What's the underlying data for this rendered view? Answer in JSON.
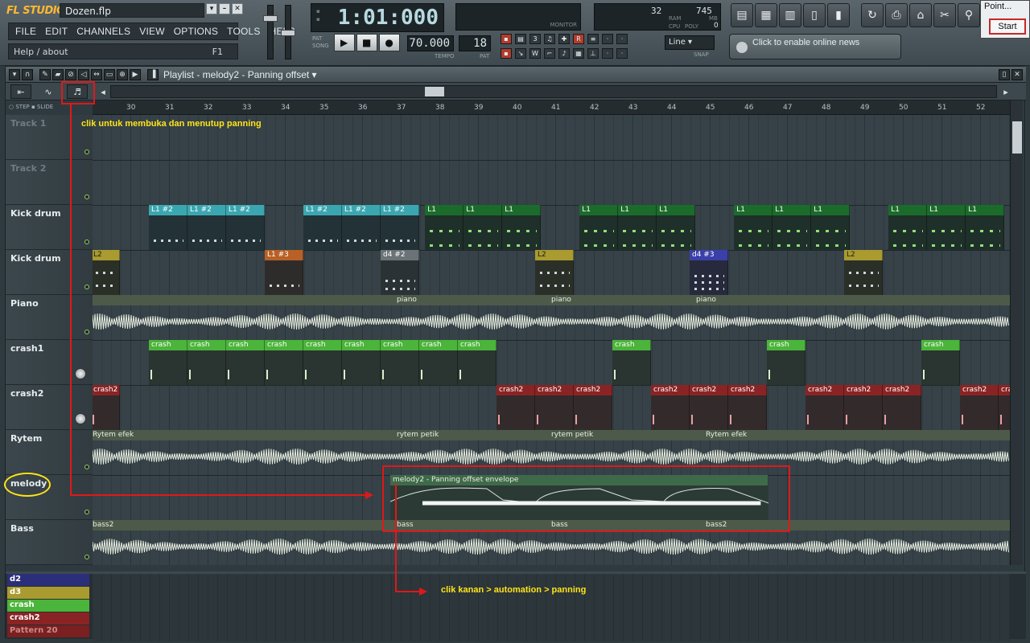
{
  "app": {
    "logo": "FL STUDIO",
    "filename": "Dozen.flp",
    "menu": [
      "FILE",
      "EDIT",
      "CHANNELS",
      "VIEW",
      "OPTIONS",
      "TOOLS",
      "HELP"
    ],
    "help_text": "Help / about",
    "help_key": "F1"
  },
  "transport": {
    "clock": "1:01:000",
    "pat_label": "PAT",
    "song_label": "SONG",
    "tempo": "70.000",
    "tempo_label": "TEMPO",
    "pattern_number": "18",
    "pattern_label": "PAT",
    "snap_value": "Line",
    "snap_label": "SNAP",
    "monitor_label": "MONITOR"
  },
  "cpu": {
    "value1": "32",
    "value2": "745",
    "ram_label": "RAM",
    "cpu_label": "CPU",
    "poly_label": "POLY",
    "mb_label": "MB",
    "poly": "0"
  },
  "news": {
    "text": "Click to enable online news"
  },
  "popup": {
    "title": "Point...",
    "button": "Start"
  },
  "playlist": {
    "title": "Playlist - melody2 - Panning offset",
    "step_label": "STEP",
    "slide_label": "SLIDE",
    "ruler": [
      "30",
      "31",
      "32",
      "33",
      "34",
      "35",
      "36",
      "37",
      "38",
      "39",
      "40",
      "41",
      "42",
      "43",
      "44",
      "45",
      "46",
      "47",
      "48",
      "49",
      "50",
      "51",
      "52"
    ],
    "tracks": [
      "Track 1",
      "Track 2",
      "Kick drum",
      "Kick drum",
      "Piano",
      "crash1",
      "crash2",
      "Rytem",
      "melody",
      "Bass"
    ],
    "clips": {
      "kick1_teal": "L1 #2",
      "kick1_green": "L1",
      "kick2_olive_left": "L2",
      "kick2_orange": "L1 #3",
      "kick2_gray": "d4 #2",
      "kick2_olive": "L2",
      "kick2_blue": "d4 #3",
      "piano": "piano",
      "crash": "crash",
      "crash2": "crash2",
      "rytem_first": "Rytem efek",
      "rytem_petik": "rytem petik",
      "rytem_last": "Rytem efek",
      "melody_env": "melody2 - Panning offset envelope",
      "bass_first": "bass2",
      "bass": "bass",
      "bass_last": "bass2"
    }
  },
  "patterns": [
    "d2",
    "d3",
    "crash",
    "crash2",
    "Pattern 20"
  ],
  "annotations": {
    "top": "clik untuk membuka dan menutup panning",
    "bottom": "clik  kanan > automation > panning"
  },
  "colors": {
    "accent_red": "#e01818",
    "annotation_yellow": "#ffe417"
  }
}
